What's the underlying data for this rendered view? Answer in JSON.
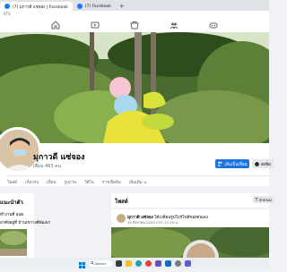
{
  "browser": {
    "tabs": [
      {
        "label": "(7) มุกาวดี แซ่จอง | Facebook",
        "active": true
      },
      {
        "label": "(7) Facebook",
        "active": false
      }
    ],
    "new_tab_symbol": "+",
    "address_text": "ETS"
  },
  "fb_nav": {
    "icons": [
      "home-icon",
      "video-icon",
      "marketplace-icon",
      "groups-icon",
      "gaming-icon"
    ]
  },
  "profile": {
    "name": "มุกาวดี แซ่จอง",
    "friends_count": "เพื่อน 463 คน",
    "add_friend_label": "เพิ่มเป็นเพื่อน",
    "message_label": "ส่งข้อ"
  },
  "profile_tabs": [
    "โพสต์",
    "เกี่ยวกับ",
    "เพื่อน",
    "รูปภาพ",
    "วิดีโอ",
    "การเช็คอิน",
    "เพิ่มเติม"
  ],
  "intro": {
    "title": "แนะนำตัว",
    "line1": "ทำงานที่ อบต.",
    "line2": "อาศัยอยู่ที่ บ้านเขาวงศ์พัฒนา"
  },
  "posts_section": {
    "title": "โพสต์",
    "filters_label": "ตัวกรอง"
  },
  "post": {
    "author": "มุกาวดี แซ่จอง",
    "action": "ได้เปลี่ยนรูปโปรไฟล์ของตนเอง",
    "date": "19 สิงหาคม 2023 เวลา 17:19 น."
  },
  "taskbar": {
    "search_label": "Search",
    "apps": [
      "windows-icon",
      "task-view-icon",
      "file-explorer-icon",
      "edge-icon",
      "chrome-icon",
      "store-icon",
      "mail-icon",
      "settings-icon",
      "teams-icon"
    ]
  },
  "colors": {
    "fb_blue": "#1877f2",
    "button_blue": "#1b74e4",
    "page_bg": "#f0f2f5"
  }
}
